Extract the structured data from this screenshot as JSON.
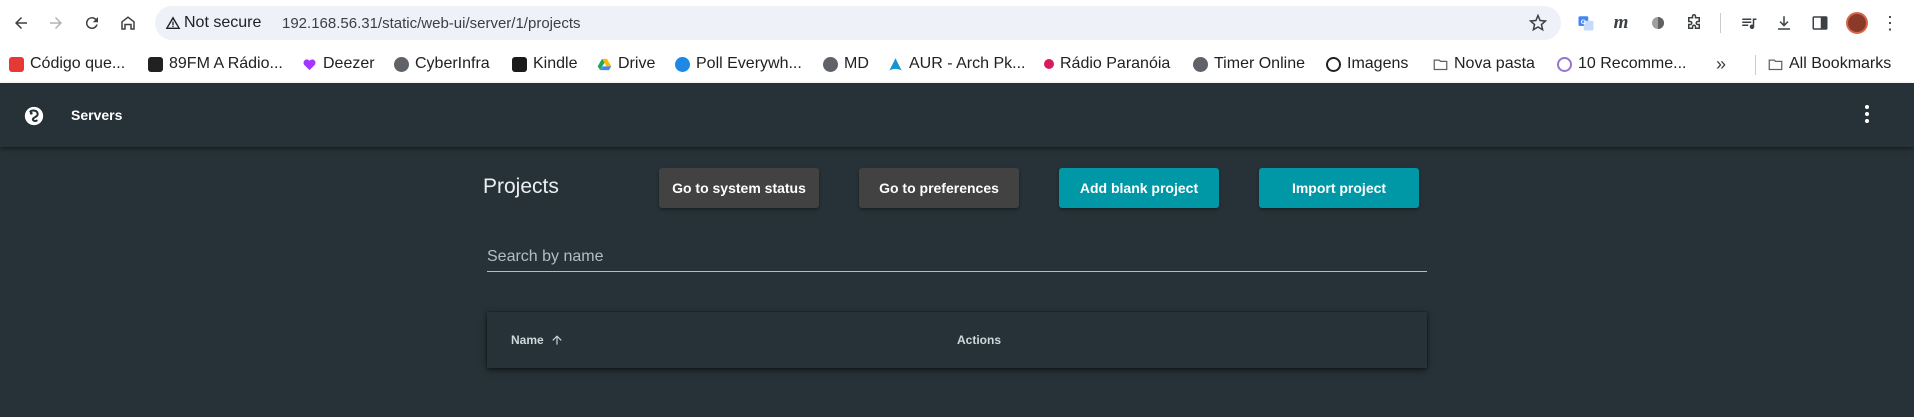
{
  "browser": {
    "security_label": "Not secure",
    "url": "192.168.56.31/static/web-ui/server/1/projects",
    "ext_m": "m"
  },
  "bookmarks": [
    {
      "label": "Código que...",
      "color": "#e53935",
      "icon": "codigo-icon"
    },
    {
      "label": "89FM A Rádio...",
      "color": "#212121",
      "icon": "radio-icon"
    },
    {
      "label": "Deezer",
      "color": "#a238ff",
      "icon": "heart-icon"
    },
    {
      "label": "CyberInfra",
      "color": "#5f6368",
      "icon": "globe-icon"
    },
    {
      "label": "Kindle",
      "color": "#1a1a1a",
      "icon": "kindle-icon"
    },
    {
      "label": "Drive",
      "color": "#1fa463",
      "icon": "drive-icon"
    },
    {
      "label": "Poll Everywh...",
      "color": "#1e88e5",
      "icon": "poll-icon"
    },
    {
      "label": "MD",
      "color": "#5f6368",
      "icon": "globe-icon"
    },
    {
      "label": "AUR - Arch Pk...",
      "color": "#1793d1",
      "icon": "arch-icon"
    },
    {
      "label": "Rádio Paranóia",
      "color": "#d81b60",
      "icon": "dot-icon"
    },
    {
      "label": "Timer Online",
      "color": "#5f6368",
      "icon": "globe-icon"
    },
    {
      "label": "Imagens",
      "color": "#202124",
      "icon": "camera-icon"
    },
    {
      "label": "Nova pasta",
      "color": "#5f6368",
      "icon": "folder-icon"
    },
    {
      "label": "10 Recomme...",
      "color": "#9575cd",
      "icon": "circle-icon"
    }
  ],
  "all_bookmarks_label": "All Bookmarks",
  "app": {
    "title": "Servers"
  },
  "main": {
    "page_title": "Projects",
    "buttons": {
      "system_status": "Go to system status",
      "preferences": "Go to preferences",
      "add_blank": "Add blank project",
      "import": "Import project"
    },
    "search_placeholder": "Search by name",
    "table": {
      "col_name": "Name",
      "col_actions": "Actions",
      "sort": "ascending"
    }
  },
  "colors": {
    "background": "#263238",
    "teal_button": "#0097a7",
    "dark_button": "#424242"
  }
}
